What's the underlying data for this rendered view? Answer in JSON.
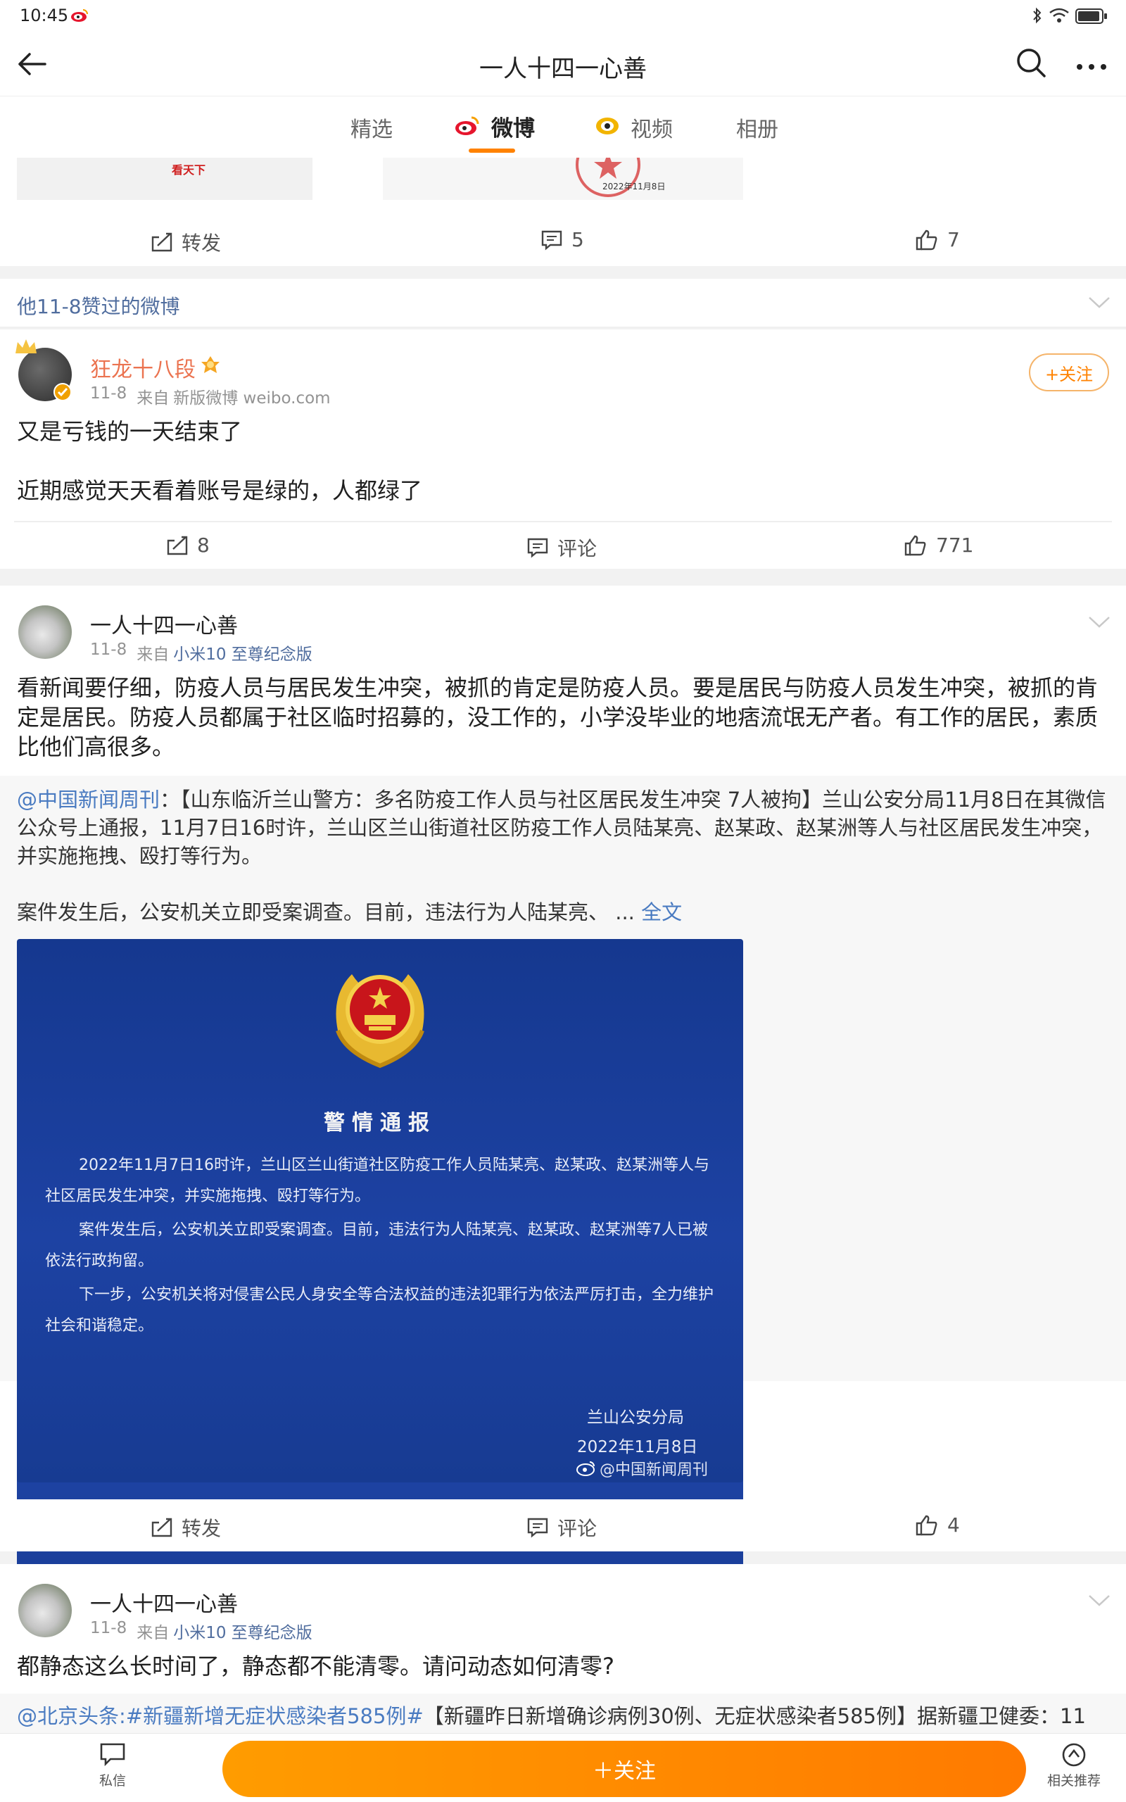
{
  "status_bar": {
    "time": "10:45"
  },
  "header": {
    "title": "一人十四一心善"
  },
  "tabs": [
    {
      "label": "精选",
      "active": false
    },
    {
      "label": "微博",
      "active": true
    },
    {
      "label": "视频",
      "active": false
    },
    {
      "label": "相册",
      "active": false
    }
  ],
  "prev_post": {
    "image_text_left": "看天下",
    "stamp_date": "2022年11月8日",
    "repost_label": "转发",
    "comment_count": "5",
    "like_count": "7"
  },
  "liked_section": {
    "label": "他11-8赞过的微博"
  },
  "post1": {
    "username": "狂龙十八段",
    "meta_date": "11-8",
    "meta_from": "来自",
    "meta_source": "新版微博 weibo.com",
    "follow_label": "+关注",
    "text_line1": "又是亏钱的一天结束了",
    "text_line2": "近期感觉天天看着账号是绿的，人都绿了",
    "repost_count": "8",
    "comment_label": "评论",
    "like_count": "771"
  },
  "post2": {
    "username": "一人十四一心善",
    "meta_date": "11-8",
    "meta_from": "来自",
    "meta_source": "小米10 至尊纪念版",
    "text": "看新闻要仔细，防疫人员与居民发生冲突，被抓的肯定是防疫人员。要是居民与防疫人员发生冲突，被抓的肯定是居民。防疫人员都属于社区临时招募的，没工作的，小学没毕业的地痞流氓无产者。有工作的居民，素质比他们高很多。",
    "quote_author": "@中国新闻周刊",
    "quote_text_1": "：【山东临沂兰山警方：多名防疫工作人员与社区居民发生冲突 7人被拘】兰山公安分局11月8日在其微信公众号上通报，11月7日16时许，兰山区兰山街道社区防疫工作人员陆某亮、赵某政、赵某洲等人与社区居民发生冲突，并实施拖拽、殴打等行为。",
    "quote_text_2": "案件发生后，公安机关立即受案调查。目前，违法行为人陆某亮、 ...",
    "full_text_link": "全文",
    "notice": {
      "title": "警情通报",
      "para1": "2022年11月7日16时许，兰山区兰山街道社区防疫工作人员陆某亮、赵某政、赵某洲等人与社区居民发生冲突，并实施拖拽、殴打等行为。",
      "para2": "案件发生后，公安机关立即受案调查。目前，违法行为人陆某亮、赵某政、赵某洲等7人已被依法行政拘留。",
      "para3": "下一步，公安机关将对侵害公民人身安全等合法权益的违法犯罪行为依法严厉打击，全力维护社会和谐稳定。",
      "signature": "兰山公安分局",
      "date": "2022年11月8日",
      "watermark": "@中国新闻周刊"
    },
    "repost_label": "转发",
    "comment_label": "评论",
    "like_count": "4"
  },
  "post3": {
    "username": "一人十四一心善",
    "meta_date": "11-8",
    "meta_from": "来自",
    "meta_source": "小米10 至尊纪念版",
    "text": "都静态这么长时间了，静态都不能清零。请问动态如何清零?",
    "quote_author": "@北京头条",
    "quote_hashtag": ":#新疆新增无症状感染者585例#",
    "quote_text": "【新疆昨日新增确诊病例30例、无症状感染者585例】据新疆卫健委：11"
  },
  "bottom_bar": {
    "message_label": "私信",
    "follow_label": "＋关注",
    "recommend_label": "相关推荐"
  },
  "colors": {
    "accent": "#ff8200",
    "link": "#4a7bc1",
    "username_orange": "#eb7350",
    "notice_bg": "#1d3b9a"
  }
}
